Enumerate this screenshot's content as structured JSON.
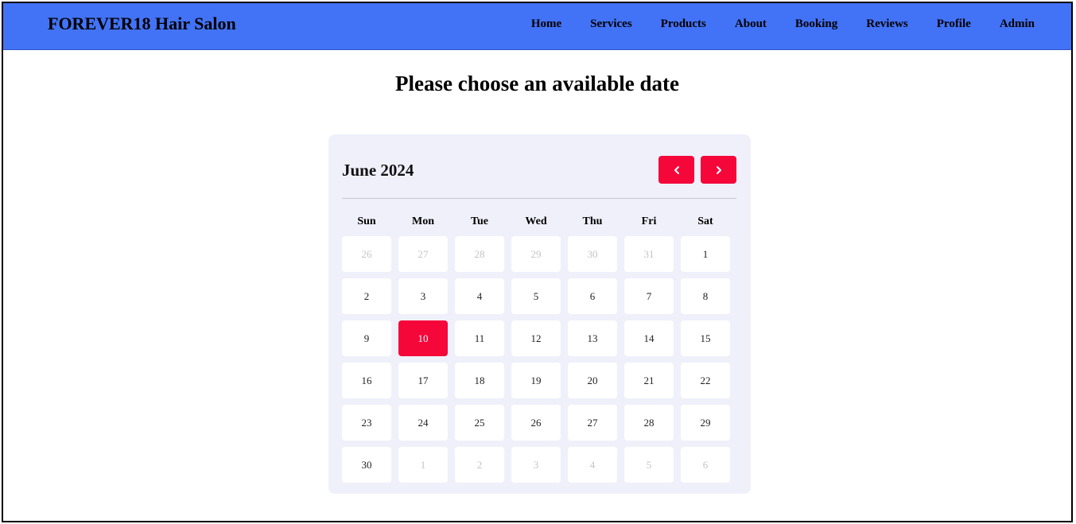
{
  "header": {
    "brand": "FOREVER18 Hair Salon",
    "nav": [
      "Home",
      "Services",
      "Products",
      "About",
      "Booking",
      "Reviews",
      "Profile",
      "Admin"
    ]
  },
  "heading": "Please choose an available date",
  "calendar": {
    "month_label": "June 2024",
    "weekdays": [
      "Sun",
      "Mon",
      "Tue",
      "Wed",
      "Thu",
      "Fri",
      "Sat"
    ],
    "days": [
      {
        "label": "26",
        "muted": true
      },
      {
        "label": "27",
        "muted": true
      },
      {
        "label": "28",
        "muted": true
      },
      {
        "label": "29",
        "muted": true
      },
      {
        "label": "30",
        "muted": true
      },
      {
        "label": "31",
        "muted": true
      },
      {
        "label": "1"
      },
      {
        "label": "2"
      },
      {
        "label": "3"
      },
      {
        "label": "4"
      },
      {
        "label": "5"
      },
      {
        "label": "6"
      },
      {
        "label": "7"
      },
      {
        "label": "8"
      },
      {
        "label": "9"
      },
      {
        "label": "10",
        "selected": true
      },
      {
        "label": "11"
      },
      {
        "label": "12"
      },
      {
        "label": "13"
      },
      {
        "label": "14"
      },
      {
        "label": "15"
      },
      {
        "label": "16"
      },
      {
        "label": "17"
      },
      {
        "label": "18"
      },
      {
        "label": "19"
      },
      {
        "label": "20"
      },
      {
        "label": "21"
      },
      {
        "label": "22"
      },
      {
        "label": "23"
      },
      {
        "label": "24"
      },
      {
        "label": "25"
      },
      {
        "label": "26"
      },
      {
        "label": "27"
      },
      {
        "label": "28"
      },
      {
        "label": "29"
      },
      {
        "label": "30"
      },
      {
        "label": "1",
        "muted": true
      },
      {
        "label": "2",
        "muted": true
      },
      {
        "label": "3",
        "muted": true
      },
      {
        "label": "4",
        "muted": true
      },
      {
        "label": "5",
        "muted": true
      },
      {
        "label": "6",
        "muted": true
      }
    ]
  },
  "colors": {
    "navbar": "#4272f5",
    "accent": "#f5073a",
    "calendar_bg": "#f0f0fb"
  },
  "icons": {
    "prev": "chevron-left-icon",
    "next": "chevron-right-icon"
  }
}
